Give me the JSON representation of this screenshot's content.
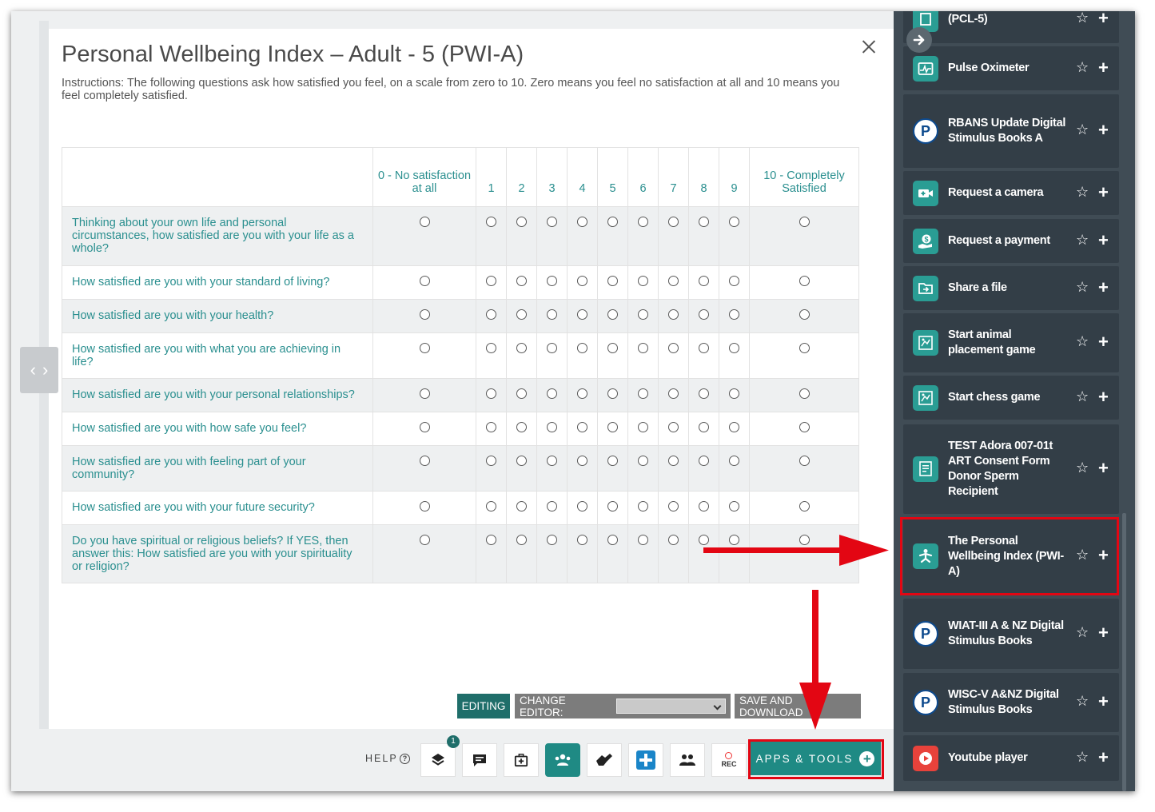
{
  "form": {
    "title": "Personal Wellbeing Index – Adult - 5 (PWI-A)",
    "instructions": "Instructions: The following questions ask how satisfied you feel, on a scale from zero to 10. Zero means you feel no satisfaction at all and 10 means you feel completely satisfied.",
    "columns": [
      "0 - No satisfaction at all",
      "1",
      "2",
      "3",
      "4",
      "5",
      "6",
      "7",
      "8",
      "9",
      "10 - Completely Satisfied"
    ],
    "questions": [
      "Thinking about your own life and personal circumstances, how satisfied are you with your life as a whole?",
      "How satisfied are you with your standard of living?",
      "How satisfied are you with your health?",
      "How satisfied are you with what you are achieving in life?",
      "How satisfied are you with your personal relationships?",
      "How satisfied are you with how safe you feel?",
      "How satisfied are you with feeling part of your community?",
      "How satisfied are you with your future security?",
      "Do you have spiritual or religious beliefs? If YES, then answer this: How satisfied are you with your spirituality or religion?"
    ]
  },
  "editor": {
    "editing_label": "EDITING",
    "change_editor_label": "CHANGE EDITOR:",
    "save_download_label": "SAVE AND DOWNLOAD"
  },
  "toolbar": {
    "help_label": "HELP",
    "badge_count": "1",
    "rec_label": "REC",
    "apps_tools_label": "APPS & TOOLS"
  },
  "sidebar": {
    "items": [
      {
        "label": "(PCL-5)",
        "icon": "clipboard-icon"
      },
      {
        "label": "Pulse Oximeter",
        "icon": "pulse-icon"
      },
      {
        "label": "RBANS Update Digital Stimulus Books A",
        "icon": "pearson-icon"
      },
      {
        "label": "Request a camera",
        "icon": "camera-icon"
      },
      {
        "label": "Request a payment",
        "icon": "payment-icon"
      },
      {
        "label": "Share a file",
        "icon": "folder-icon"
      },
      {
        "label": "Start animal placement game",
        "icon": "game-icon"
      },
      {
        "label": "Start chess game",
        "icon": "game-icon"
      },
      {
        "label": "TEST Adora 007-01t ART Consent Form Donor Sperm Recipient",
        "icon": "form-icon"
      },
      {
        "label": "The Personal Wellbeing Index (PWI-A)",
        "icon": "wellbeing-icon"
      },
      {
        "label": "WIAT-III A & NZ Digital Stimulus Books",
        "icon": "pearson-icon"
      },
      {
        "label": "WISC-V A&NZ Digital Stimulus Books",
        "icon": "pearson-icon"
      },
      {
        "label": "Youtube player",
        "icon": "play-icon"
      }
    ]
  },
  "colors": {
    "accent": "#1f8a84",
    "sidebar_bg": "#404c55",
    "card_bg": "#333e47",
    "highlight": "#e30613"
  }
}
